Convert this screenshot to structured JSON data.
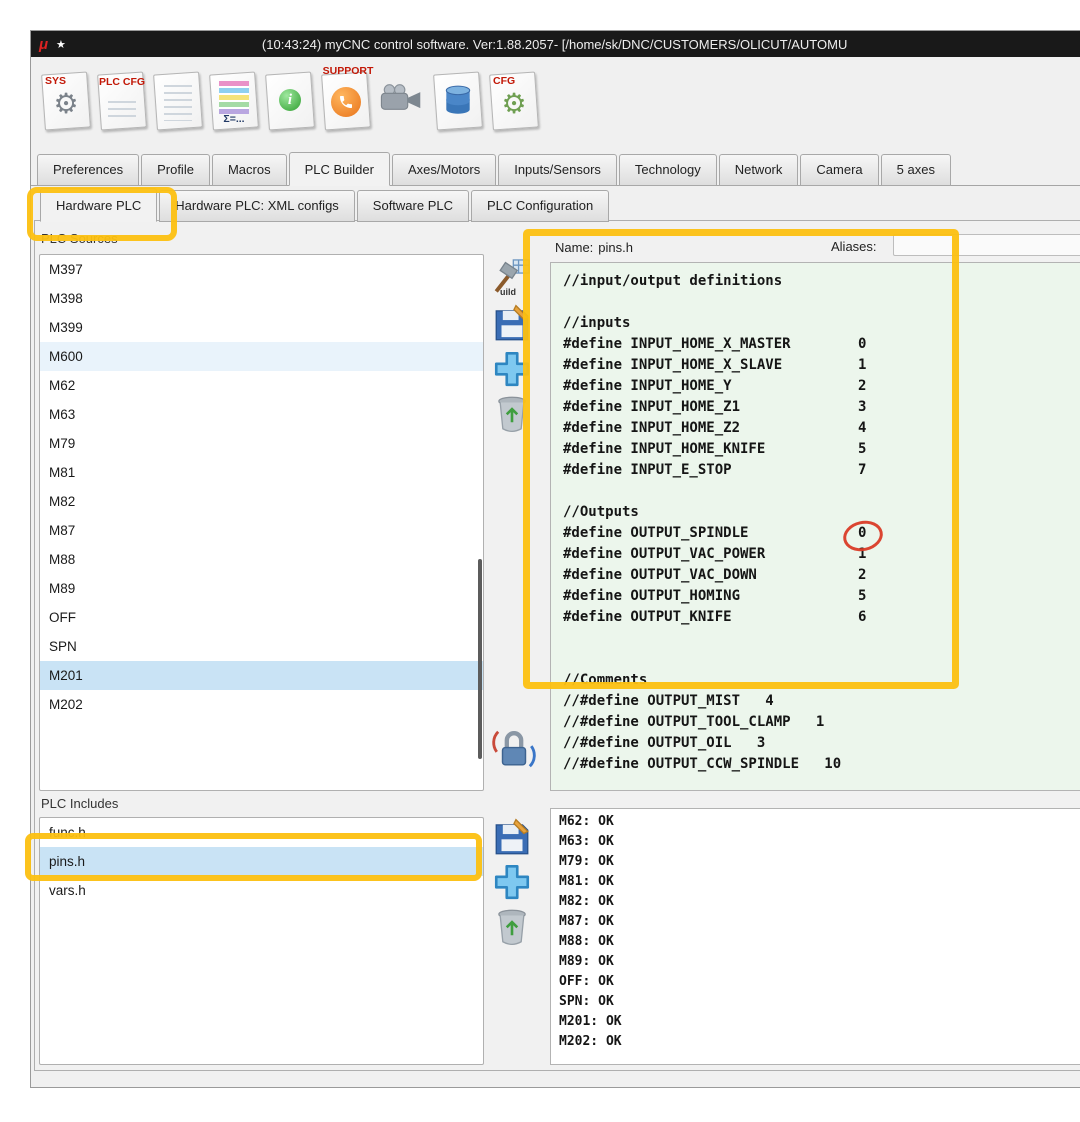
{
  "titlebar": {
    "app_glyph": "μ",
    "pin_glyph": "★",
    "title": "(10:43:24) myCNC control software. Ver:1.88.2057- [/home/sk/DNC/CUSTOMERS/OLICUT/AUTOMU"
  },
  "toolbar": {
    "sys_label": "SYS",
    "plc_cfg_label": "PLC CFG",
    "sigma_label": "Σ=...",
    "info_glyph": "i",
    "support_label": "SUPPORT",
    "cfg_label": "CFG"
  },
  "main_tabs": {
    "items": [
      "Preferences",
      "Profile",
      "Macros",
      "PLC Builder",
      "Axes/Motors",
      "Inputs/Sensors",
      "Technology",
      "Network",
      "Camera",
      "5 axes"
    ],
    "selected": "PLC Builder"
  },
  "sub_tabs": {
    "items": [
      "Hardware PLC",
      "Hardware PLC: XML configs",
      "Software PLC",
      "PLC Configuration"
    ],
    "selected": "Hardware PLC"
  },
  "sources": {
    "label": "PLC Sources",
    "items": [
      "M397",
      "M398",
      "M399",
      "M600",
      "M62",
      "M63",
      "M79",
      "M81",
      "M82",
      "M87",
      "M88",
      "M89",
      "OFF",
      "SPN",
      "M201",
      "M202"
    ],
    "selected": "M201",
    "highlighted": "M600"
  },
  "source_tools": {
    "build_label": "uild"
  },
  "editor": {
    "name_label": "Name:",
    "name_value": "pins.h",
    "aliases_label": "Aliases:",
    "aliases_value": "",
    "code_lines": [
      "//input/output definitions",
      "",
      "//inputs",
      "#define INPUT_HOME_X_MASTER        0",
      "#define INPUT_HOME_X_SLAVE         1",
      "#define INPUT_HOME_Y               2",
      "#define INPUT_HOME_Z1              3",
      "#define INPUT_HOME_Z2              4",
      "#define INPUT_HOME_KNIFE           5",
      "#define INPUT_E_STOP               7",
      "",
      "//Outputs",
      "#define OUTPUT_SPINDLE             0",
      "#define OUTPUT_VAC_POWER           1",
      "#define OUTPUT_VAC_DOWN            2",
      "#define OUTPUT_HOMING              5",
      "#define OUTPUT_KNIFE               6",
      "",
      "",
      "//Comments",
      "//#define OUTPUT_MIST   4",
      "//#define OUTPUT_TOOL_CLAMP   1",
      "//#define OUTPUT_OIL   3",
      "//#define OUTPUT_CCW_SPINDLE   10"
    ]
  },
  "includes": {
    "label": "PLC Includes",
    "items": [
      "func.h",
      "pins.h",
      "vars.h"
    ],
    "selected": "pins.h"
  },
  "log": {
    "lines": [
      "M62: OK",
      "M63: OK",
      "M79: OK",
      "M81: OK",
      "M82: OK",
      "M87: OK",
      "M88: OK",
      "M89: OK",
      "OFF: OK",
      "SPN: OK",
      "M201: OK",
      "M202: OK"
    ]
  },
  "annotations": {
    "marker_color": "#fcc011",
    "red_color": "#da3b27"
  }
}
